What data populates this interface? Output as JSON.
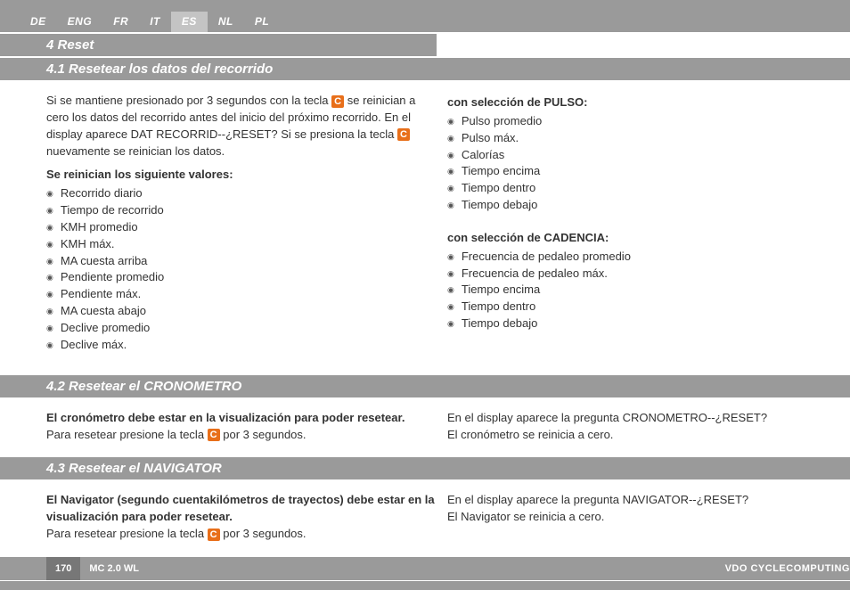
{
  "langs": [
    "DE",
    "ENG",
    "FR",
    "IT",
    "ES",
    "NL",
    "PL"
  ],
  "active_lang": "ES",
  "h_main": "4 Reset",
  "s41": {
    "title": "4.1 Resetear los datos del recorrido",
    "intro_a": "Si se mantiene presionado por 3 segundos con la tecla ",
    "intro_b": " se reinician a cero los datos del recorrido antes del inicio del próximo recorrido. En el display aparece DAT RECORRID--¿RESET? Si se presiona la tecla ",
    "intro_c": " nuevamente se reinician los datos.",
    "list_head": "Se reinician los siguiente valores:",
    "list": [
      "Recorrido diario",
      "Tiempo de recorrido",
      "KMH promedio",
      "KMH máx.",
      "MA cuesta arriba",
      "Pendiente promedio",
      "Pendiente máx.",
      "MA cuesta abajo",
      "Declive promedio",
      "Declive máx."
    ],
    "pulso_head": "con selección de PULSO:",
    "pulso_list": [
      "Pulso promedio",
      "Pulso máx.",
      "Calorías",
      "Tiempo encima",
      "Tiempo dentro",
      "Tiempo debajo"
    ],
    "cad_head": "con selección de CADENCIA:",
    "cad_list": [
      "Frecuencia de pedaleo promedio",
      "Frecuencia de pedaleo máx.",
      "Tiempo encima",
      "Tiempo dentro",
      "Tiempo debajo"
    ]
  },
  "s42": {
    "title": "4.2 Resetear el CRONOMETRO",
    "left_bold": "El cronómetro debe estar en la visualización para poder resetear.",
    "left_a": "Para resetear presione la tecla ",
    "left_b": " por 3 segundos.",
    "right_a": "En el display aparece la pregunta CRONOMETRO--¿RESET?",
    "right_b": "El cronómetro se reinicia a cero."
  },
  "s43": {
    "title": "4.3 Resetear el NAVIGATOR",
    "left_bold": "El Navigator (segundo cuentakilómetros de trayectos) debe estar en la visualización para poder resetear.",
    "left_a": "Para resetear presione la tecla ",
    "left_b": " por 3 segundos.",
    "right_a": "En el display aparece la pregunta NAVIGATOR--¿RESET?",
    "right_b": "El Navigator se reinicia a cero."
  },
  "c_key": "C",
  "footer": {
    "page": "170",
    "model": "MC 2.0 WL",
    "brand": "VDO CYCLECOMPUTING"
  }
}
